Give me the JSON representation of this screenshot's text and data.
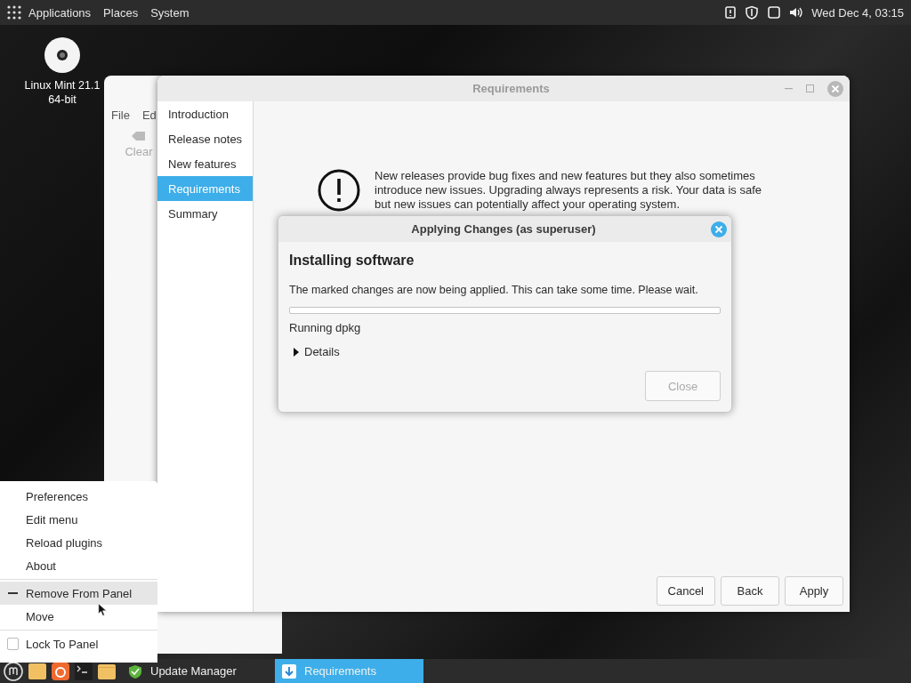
{
  "top_panel": {
    "menus": [
      "Applications",
      "Places",
      "System"
    ],
    "clock": "Wed Dec 4, 03:15"
  },
  "desktop_icon": {
    "label_lines": [
      "Linux Mint 21.1",
      "64-bit"
    ]
  },
  "back_window": {
    "menus": [
      "File",
      "Ed"
    ],
    "toolbar_button": {
      "label": "Clear",
      "disabled": true
    }
  },
  "main_window": {
    "title": "Requirements",
    "sidebar": [
      {
        "label": "Introduction",
        "selected": false
      },
      {
        "label": "Release notes",
        "selected": false
      },
      {
        "label": "New features",
        "selected": false
      },
      {
        "label": "Requirements",
        "selected": true
      },
      {
        "label": "Summary",
        "selected": false
      }
    ],
    "message": "New releases provide bug fixes and new features but they also sometimes introduce new issues. Upgrading always represents a risk. Your data is safe but new issues can potentially affect your operating system.",
    "buttons": [
      "Cancel",
      "Back",
      "Apply"
    ]
  },
  "dialog": {
    "title": "Applying Changes (as superuser)",
    "heading": "Installing software",
    "message": "The marked changes are now being applied. This can take some time. Please wait.",
    "progress": {
      "level": 0
    },
    "status": "Running dpkg",
    "details": {
      "label": "Details",
      "expanded": false
    },
    "close_button": {
      "label": "Close",
      "disabled": true
    }
  },
  "context_menu": {
    "items": [
      {
        "kind": "plain",
        "label": "Preferences",
        "highlighted": false
      },
      {
        "kind": "plain",
        "label": "Edit menu",
        "highlighted": false
      },
      {
        "kind": "plain",
        "label": "Reload plugins",
        "highlighted": false
      },
      {
        "kind": "plain",
        "label": "About",
        "highlighted": false
      },
      {
        "kind": "separator"
      },
      {
        "kind": "remove",
        "label": "Remove From Panel",
        "highlighted": true
      },
      {
        "kind": "plain",
        "label": "Move",
        "highlighted": false
      },
      {
        "kind": "separator"
      },
      {
        "kind": "check",
        "label": "Lock To Panel",
        "checked": false,
        "highlighted": false
      }
    ]
  },
  "taskbar": {
    "windows": [
      {
        "label": "Update Manager",
        "selected": false
      },
      {
        "label": "Requirements",
        "selected": true
      }
    ]
  }
}
